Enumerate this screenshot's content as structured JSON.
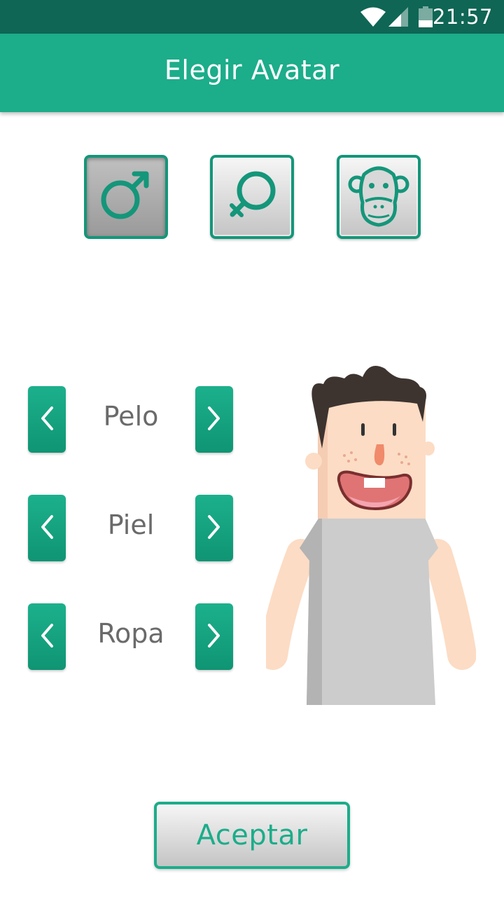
{
  "status_bar": {
    "time": "21:57",
    "icons": [
      "wifi-icon",
      "signal-icon",
      "battery-icon"
    ]
  },
  "app_bar": {
    "title": "Elegir Avatar"
  },
  "avatar_types": [
    {
      "icon": "male-symbol-icon",
      "selected": true
    },
    {
      "icon": "female-symbol-icon",
      "selected": false
    },
    {
      "icon": "monkey-face-icon",
      "selected": false
    }
  ],
  "options": [
    {
      "label": "Pelo"
    },
    {
      "label": "Piel"
    },
    {
      "label": "Ropa"
    }
  ],
  "accept_button": {
    "label": "Aceptar"
  },
  "colors": {
    "status_bar": "#0f6654",
    "app_bar": "#1cad8a",
    "accent": "#14967a",
    "hair": "#3d3430",
    "skin": "#fcdcc4",
    "shirt": "#cccccc",
    "nose": "#f08a6a"
  }
}
